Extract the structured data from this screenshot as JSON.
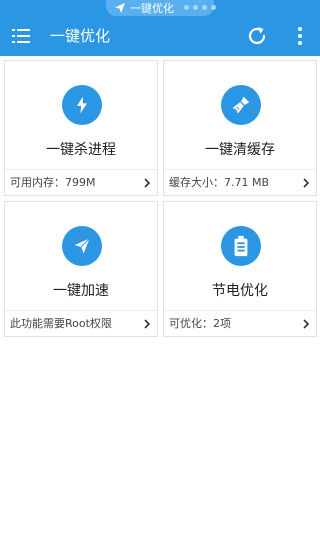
{
  "status_bar": {
    "label": "一键优化"
  },
  "toolbar": {
    "title": "一键优化"
  },
  "cards": [
    {
      "title": "一键杀进程",
      "footer": "可用内存：799M"
    },
    {
      "title": "一键清缓存",
      "footer": "缓存大小：7.71 MB"
    },
    {
      "title": "一键加速",
      "footer": "此功能需要Root权限"
    },
    {
      "title": "节电优化",
      "footer": "可优化：2项"
    }
  ],
  "colors": {
    "accent": "#2b97e4"
  },
  "icons": [
    "lightning-icon",
    "broom-icon",
    "paper-plane-icon",
    "battery-icon"
  ]
}
